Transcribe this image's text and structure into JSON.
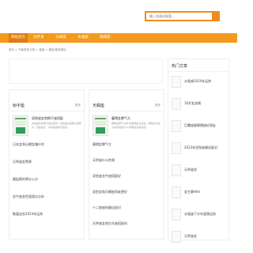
{
  "search": {
    "placeholder": "输入关键词搜索..."
  },
  "nav": {
    "items": [
      "网站首页",
      "剑手身",
      "天蝎座",
      "水瓶座",
      "摩羯座"
    ]
  },
  "breadcrumb": "首页 > 书面表述分类 > 星座 > 星座/星座情话",
  "columns": [
    {
      "title": "射手座",
      "more": "更多",
      "featured": {
        "title": "双鱼座女和狮子座搭配",
        "desc": "双鱼座女和狮子座匹配吗？双鱼座女和狮子座配对 · 双鱼座女：水象星座的双鱼座..."
      },
      "list": [
        "日本女和天蝎女赚什钞",
        "天秤座女警察",
        "最起薪的嗯水公分",
        "金牛座女性面相点分析",
        "聚喜这些2023年运势"
      ]
    },
    {
      "title": "天蝎座",
      "more": "更多",
      "featured": {
        "title": "蘑羯女脾气大",
        "desc": "蘑羯女脾气大吗?对蘑羯女生来说，蘑羯女生最大的问题是什么?蘑羯女最好别惹..."
      },
      "list": [
        "摩羯女脾气大",
        "天秤座什么性格",
        "双鱼座金牛座搭配好",
        "双鱼女和天蝎座男谁更好",
        "十二星座的最佳配对",
        "天秤座女和白羊座搭配吗"
      ]
    }
  ],
  "sidebar": {
    "title": "热门文章",
    "items": [
      "水瓶座2024年运势",
      "16岁女孩属",
      "巨蟹座跟摩羯座好朋友",
      "2023年双鱼座最佳配对",
      "天秤座男",
      "女生静Hhh",
      "水瓶座下半年爱情运势",
      "天秤座女"
    ]
  }
}
